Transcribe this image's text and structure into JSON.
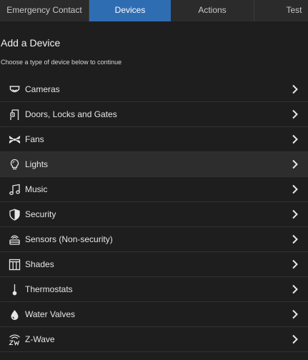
{
  "tabs": [
    {
      "label": "Emergency Contact",
      "active": false
    },
    {
      "label": "Devices",
      "active": true
    },
    {
      "label": "Actions",
      "active": false
    },
    {
      "label": "Test",
      "active": false
    }
  ],
  "header": {
    "title": "Add a Device",
    "subtitle": "Choose a type of device below to continue"
  },
  "devices": [
    {
      "label": "Cameras",
      "icon": "camera-icon"
    },
    {
      "label": "Doors, Locks and Gates",
      "icon": "door-lock-icon"
    },
    {
      "label": "Fans",
      "icon": "fan-icon"
    },
    {
      "label": "Lights",
      "icon": "lightbulb-icon"
    },
    {
      "label": "Music",
      "icon": "music-note-icon"
    },
    {
      "label": "Security",
      "icon": "shield-icon"
    },
    {
      "label": "Sensors (Non-security)",
      "icon": "sensor-icon"
    },
    {
      "label": "Shades",
      "icon": "shades-icon"
    },
    {
      "label": "Thermostats",
      "icon": "thermometer-icon"
    },
    {
      "label": "Water Valves",
      "icon": "water-drop-icon"
    },
    {
      "label": "Z-Wave",
      "icon": "zwave-icon"
    }
  ],
  "colors": {
    "background": "#1e1e1e",
    "tabbar": "#2b2b2b",
    "active_tab": "#2f6db3",
    "highlight_row": "#2d2d2d"
  }
}
